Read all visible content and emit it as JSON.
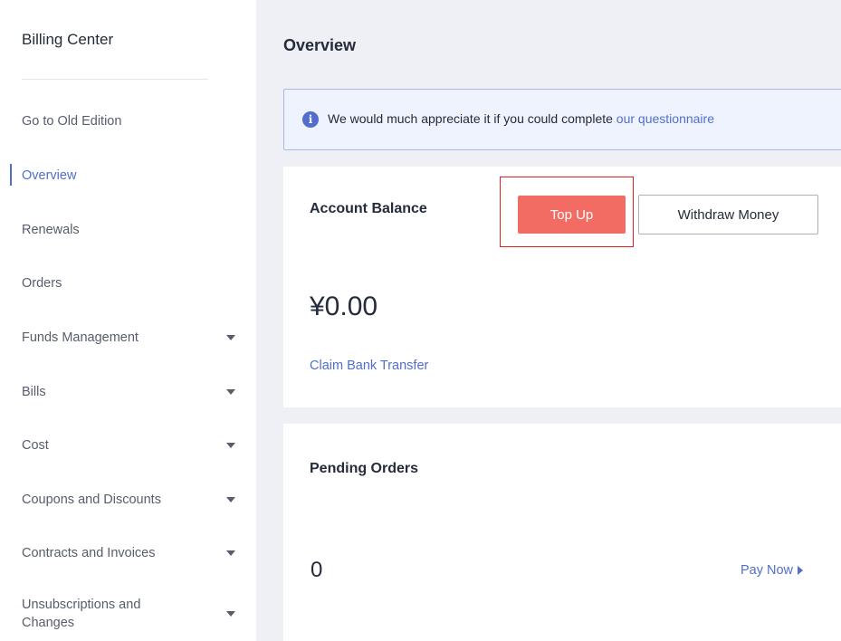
{
  "sidebar": {
    "title": "Billing Center",
    "items": [
      {
        "label": "Go to Old Edition"
      },
      {
        "label": "Overview"
      },
      {
        "label": "Renewals"
      },
      {
        "label": "Orders"
      },
      {
        "label": "Funds Management"
      },
      {
        "label": "Bills"
      },
      {
        "label": "Cost"
      },
      {
        "label": "Coupons and Discounts"
      },
      {
        "label": "Contracts and Invoices"
      },
      {
        "label": "Unsubscriptions and Changes"
      }
    ],
    "active_item": "Overview"
  },
  "main": {
    "title": "Overview",
    "notice": {
      "icon": "info-icon",
      "text": "We would much appreciate it if you could complete ",
      "link": "our questionnaire"
    },
    "balance": {
      "title": "Account Balance",
      "top_up_label": "Top Up",
      "withdraw_label": "Withdraw Money",
      "amount": "¥0.00",
      "claim_link": "Claim Bank Transfer"
    },
    "pending": {
      "title": "Pending Orders",
      "count": "0",
      "pay_now_label": "Pay Now"
    }
  },
  "colors": {
    "accent": "#526ecc",
    "top_up_button": "#f36c64",
    "highlight_box": "#e02020",
    "main_background": "#eef0f5",
    "notice_background": "#eef3fd"
  }
}
